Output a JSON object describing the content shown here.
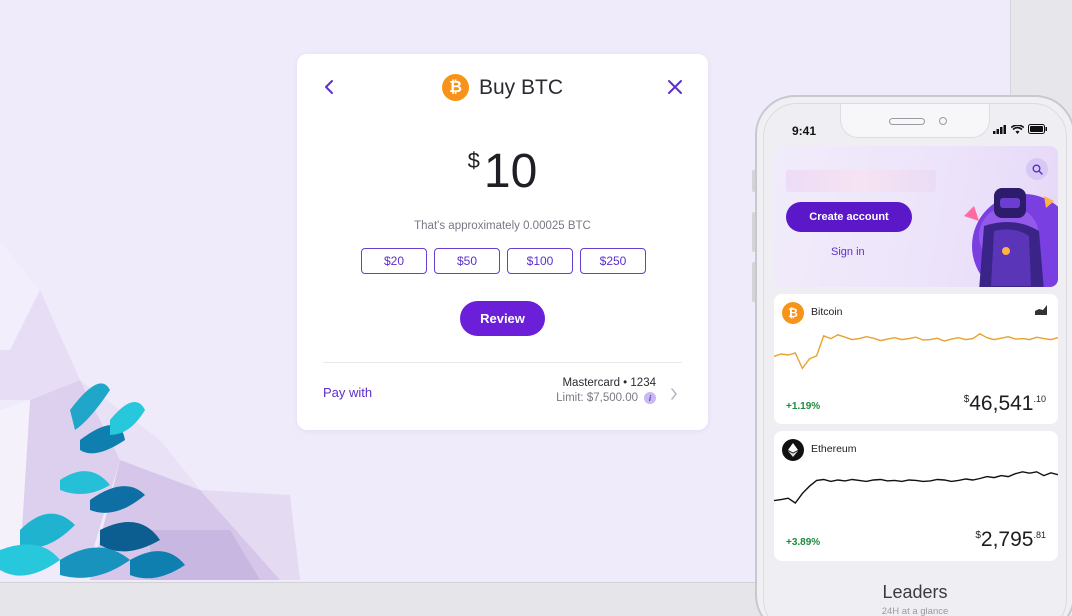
{
  "buy_card": {
    "title": "Buy BTC",
    "coin_symbol": "₿",
    "currency_symbol": "$",
    "amount": "10",
    "approx_text": "That's approximately 0.00025 BTC",
    "presets": [
      "$20",
      "$50",
      "$100",
      "$250"
    ],
    "review_label": "Review",
    "pay_with_label": "Pay with",
    "card_name": "Mastercard • 1234",
    "limit_text": "Limit: $7,500.00",
    "info_glyph": "i",
    "back_icon": "chevron-left-icon",
    "close_icon": "close-icon"
  },
  "phone": {
    "status_time": "9:41",
    "create_account_label": "Create account",
    "sign_in_label": "Sign in",
    "coins": [
      {
        "name": "Bitcoin",
        "symbol": "₿",
        "change": "+1.19%",
        "price_symbol": "$",
        "price": "46,541",
        "price_cents": ".10",
        "color": "#f7931a",
        "line_color": "#e8a230",
        "trend": [
          0.45,
          0.5,
          0.48,
          0.52,
          0.2,
          0.4,
          0.46,
          0.88,
          0.82,
          0.9,
          0.85,
          0.8,
          0.82,
          0.86,
          0.83,
          0.78,
          0.81,
          0.84,
          0.8,
          0.82,
          0.85,
          0.79,
          0.8,
          0.83,
          0.77,
          0.81,
          0.84,
          0.8,
          0.82,
          0.92,
          0.84,
          0.8,
          0.83,
          0.86,
          0.81,
          0.82,
          0.8,
          0.85,
          0.82,
          0.8,
          0.84
        ]
      },
      {
        "name": "Ethereum",
        "symbol": "◆",
        "change": "+3.89%",
        "price_symbol": "$",
        "price": "2,795",
        "price_cents": ".81",
        "color": "#111111",
        "line_color": "#111111",
        "trend": [
          0.3,
          0.32,
          0.35,
          0.25,
          0.45,
          0.6,
          0.72,
          0.74,
          0.7,
          0.73,
          0.71,
          0.74,
          0.72,
          0.7,
          0.73,
          0.74,
          0.71,
          0.72,
          0.7,
          0.73,
          0.72,
          0.7,
          0.71,
          0.74,
          0.73,
          0.7,
          0.72,
          0.75,
          0.73,
          0.76,
          0.8,
          0.78,
          0.82,
          0.8,
          0.86,
          0.9,
          0.87,
          0.9,
          0.82,
          0.88,
          0.84
        ]
      }
    ],
    "leaders_title": "Leaders",
    "leaders_subtitle": "24H at a glance"
  }
}
